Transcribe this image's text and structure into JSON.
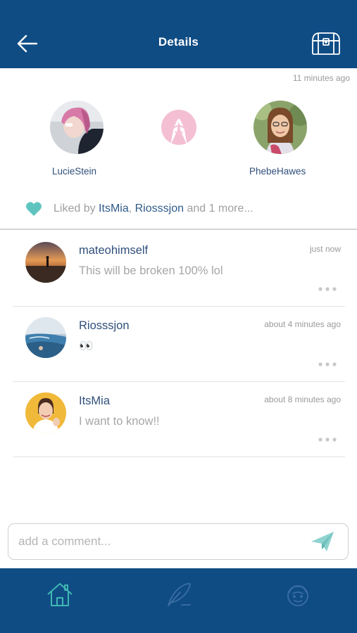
{
  "header": {
    "title": "Details",
    "back_icon": "arrow-left-icon",
    "action_icon": "treasure-chest-icon"
  },
  "post": {
    "timestamp": "11 minutes ago",
    "left_user": "LucieStein",
    "right_user": "PhebeHawes",
    "center_icon": "pinky-promise-icon",
    "likes": {
      "prefix": "Liked by",
      "user1": "ItsMia",
      "separator": ",",
      "user2": "Riosssjon",
      "suffix": "and 1 more..."
    }
  },
  "comments": [
    {
      "user": "mateohimself",
      "time": "just now",
      "text": "This will be broken 100% lol"
    },
    {
      "user": "Riosssjon",
      "time": "about 4 minutes ago",
      "text": "👀"
    },
    {
      "user": "ItsMia",
      "time": "about 8 minutes ago",
      "text": "I want to know!!"
    }
  ],
  "composer": {
    "placeholder": "add a comment...",
    "send_icon": "paper-plane-icon"
  },
  "bottom_nav": [
    {
      "icon": "home-icon",
      "active": true
    },
    {
      "icon": "feather-pen-icon",
      "active": false
    },
    {
      "icon": "profile-face-icon",
      "active": false
    }
  ],
  "colors": {
    "brand": "#0f4c84",
    "accent": "#3fb7b3",
    "name_text": "#2f4f7a",
    "muted_text": "#a6a6a6",
    "heart": "#5fc4bf",
    "promise_icon": "#f2b8cf"
  }
}
